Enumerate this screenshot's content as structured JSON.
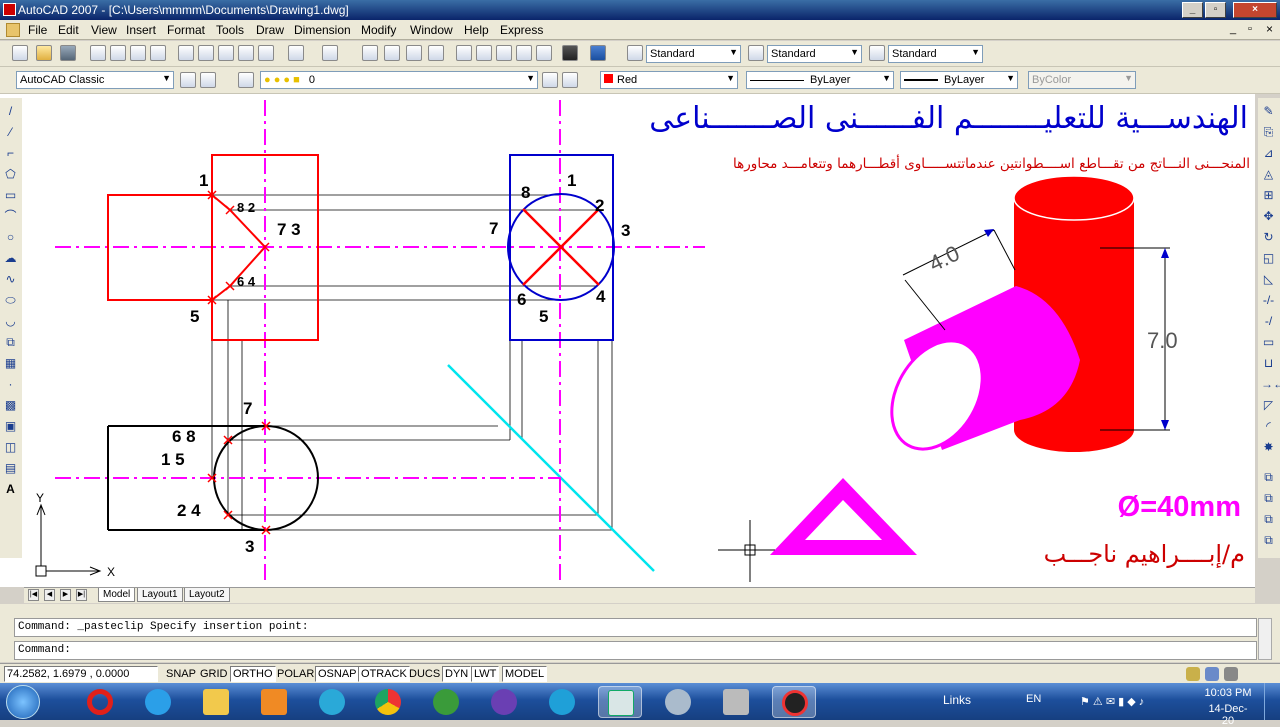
{
  "window": {
    "title": "AutoCAD 2007 - [C:\\Users\\mmmm\\Documents\\Drawing1.dwg]",
    "doc_controls": [
      "_",
      "▫",
      "×"
    ]
  },
  "menu": [
    "File",
    "Edit",
    "View",
    "Insert",
    "Format",
    "Tools",
    "Draw",
    "Dimension",
    "Modify",
    "Window",
    "Help",
    "Express"
  ],
  "styles_toolbar": {
    "text_style": "Standard",
    "dim_style": "Standard",
    "table_style": "Standard"
  },
  "workspace": "AutoCAD Classic",
  "layer": "0",
  "properties": {
    "color": "Red",
    "linetype": "ByLayer",
    "lineweight": "ByLayer",
    "plotstyle": "ByColor"
  },
  "colors": {
    "red": "#ff0000",
    "blue": "#0000cc",
    "magenta": "#ff00ff",
    "cyan": "#00e5ee",
    "accent": "#0a246a"
  },
  "drawing": {
    "heading_ar": "الهندســـية للتعليــــــــم الفــــــنى الصـــــــناعى",
    "subheading_ar": "المنحـــنى النـــاتج من تقـــاطع اســــطوانتين عندماتتســـــاوى أقطـــارهما وتتعامـــد محاورها",
    "diameter_note": "Ø=40mm",
    "author_ar": "م/إبــــراهيم ناجـــب",
    "dim_diameter": "4.0",
    "dim_height": "7.0",
    "front_labels": [
      "1",
      "8 2",
      "7 3",
      "6 4",
      "5"
    ],
    "side_labels": [
      "1",
      "8",
      "2",
      "7",
      "3",
      "6",
      "4",
      "5"
    ],
    "top_labels": [
      "7",
      "6 8",
      "1 5",
      "2 4",
      "3"
    ],
    "ucs_x": "X",
    "ucs_y": "Y"
  },
  "layout_tabs": [
    "Model",
    "Layout1",
    "Layout2"
  ],
  "command": {
    "history": "Command: _pasteclip Specify insertion point:",
    "prompt": "Command:"
  },
  "status": {
    "coords": "74.2582, 1.6979 , 0.0000",
    "toggles": [
      "SNAP",
      "GRID",
      "ORTHO",
      "POLAR",
      "OSNAP",
      "OTRACK",
      "DUCS",
      "DYN",
      "LWT",
      "MODEL"
    ],
    "toggles_on": [
      "ORTHO",
      "OSNAP",
      "OTRACK",
      "DYN",
      "LWT",
      "MODEL"
    ]
  },
  "taskbar": {
    "links": "Links",
    "lang": "EN",
    "time": "10:03 PM",
    "date": "14-Dec-20"
  }
}
